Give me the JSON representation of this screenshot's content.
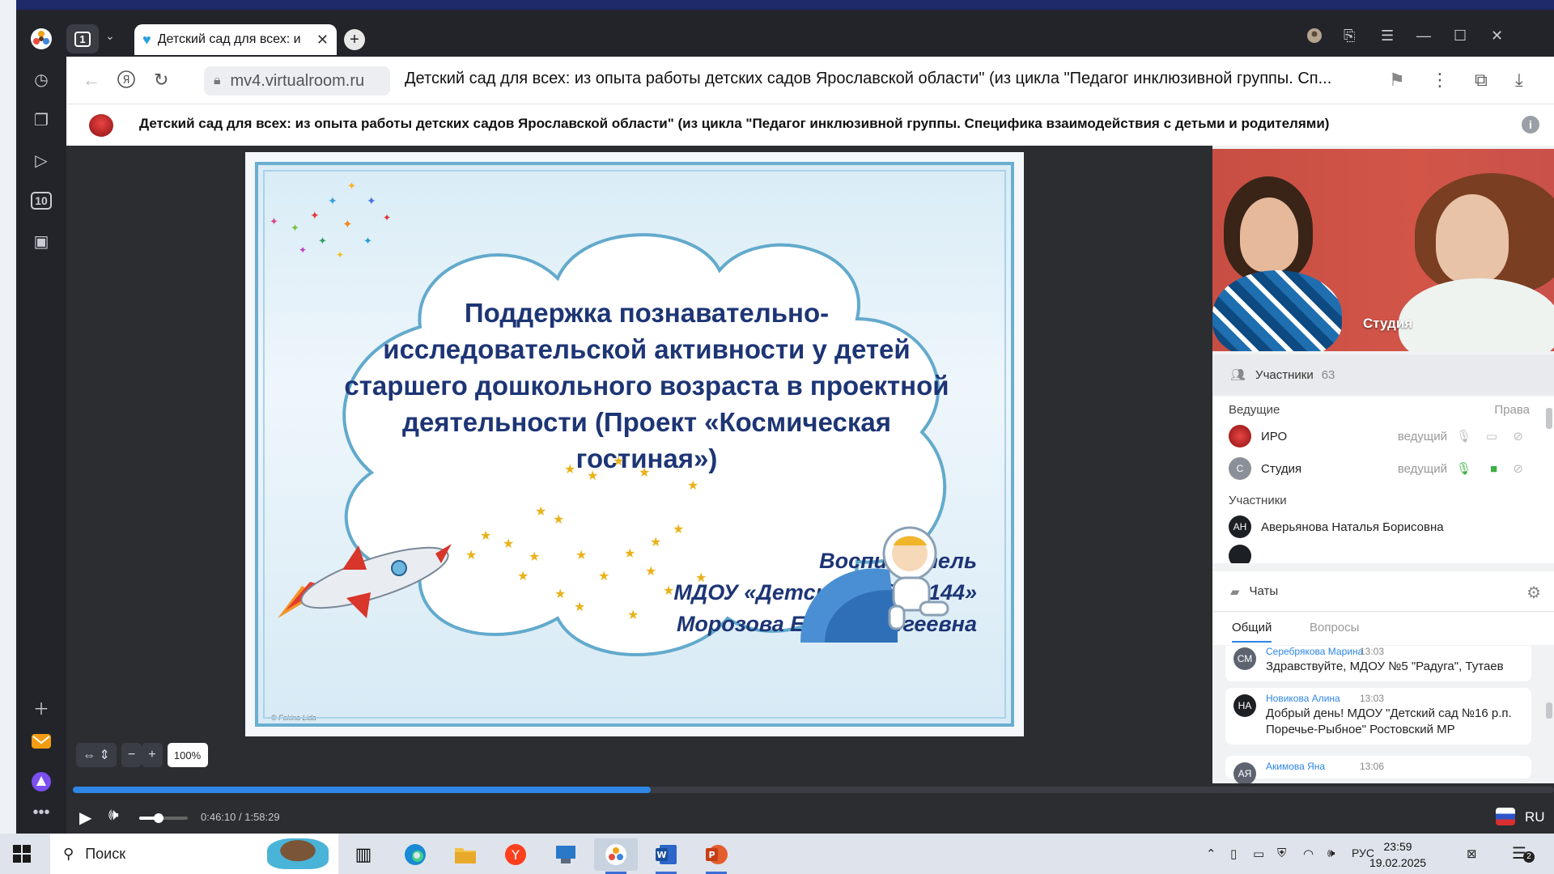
{
  "browser": {
    "tab_count": "1",
    "tab_title": "Детский сад для всех: и",
    "url_domain": "mv4.virtualroom.ru",
    "page_title": "Детский сад для всех: из опыта работы детских садов Ярославской области\" (из цикла \"Педагог инклюзивной группы. Сп..."
  },
  "site": {
    "title": "Детский сад для всех: из опыта работы детских садов Ярославской области\" (из цикла \"Педагог инклюзивной группы. Специфика взаимодействия с детьми и родителями)"
  },
  "slide": {
    "heading": "Поддержка познавательно-исследовательской активности у детей старшего дошкольного возраста в проектной деятельности (Проект «Космическая гостиная»)",
    "author_role": "Воспитатель",
    "author_org": "МДОУ «Детский сад №144»",
    "author_name": "Морозова Елена Сергеевна",
    "credit": "© Fokina Lida"
  },
  "viewer": {
    "zoom": "100%"
  },
  "player": {
    "time": "0:46:10 / 1:58:29",
    "progress_fraction": 0.39,
    "volume_fraction": 0.4,
    "lang": "RU"
  },
  "video": {
    "label": "Студия"
  },
  "participants": {
    "title": "Участники",
    "count": "63",
    "hosts_label": "Ведущие",
    "rights_label": "Права",
    "hosts": [
      {
        "name": "ИРО",
        "role": "ведущий"
      },
      {
        "name": "Студия",
        "role": "ведущий",
        "initial": "С"
      }
    ],
    "members_label": "Участники",
    "members": [
      {
        "initials": "АН",
        "name": "Аверьянова Наталья Борисовна"
      }
    ]
  },
  "chats": {
    "title": "Чаты",
    "tabs": [
      "Общий",
      "Вопросы"
    ],
    "messages": [
      {
        "initials": "СМ",
        "author": "Серебрякова Марина",
        "time": "13:03",
        "text": "Здравствуйте, МДОУ №5 \"Радуга\", Тутаев"
      },
      {
        "initials": "НА",
        "author": "Новикова Алина",
        "time": "13:03",
        "text": "Добрый день! МДОУ \"Детский сад №16 р.п. Поречье-Рыбное\" Ростовский МР"
      },
      {
        "initials": "АЯ",
        "author": "Акимова Яна",
        "time": "13:06",
        "text": ""
      }
    ]
  },
  "taskbar": {
    "search_label": "Поиск",
    "lang": "РУС",
    "time": "23:59",
    "date": "19.02.2025",
    "notif_count": "2"
  },
  "colors": {
    "accent": "#2e86e6",
    "slide_text": "#1d3575",
    "mic_on": "#3cb043"
  }
}
